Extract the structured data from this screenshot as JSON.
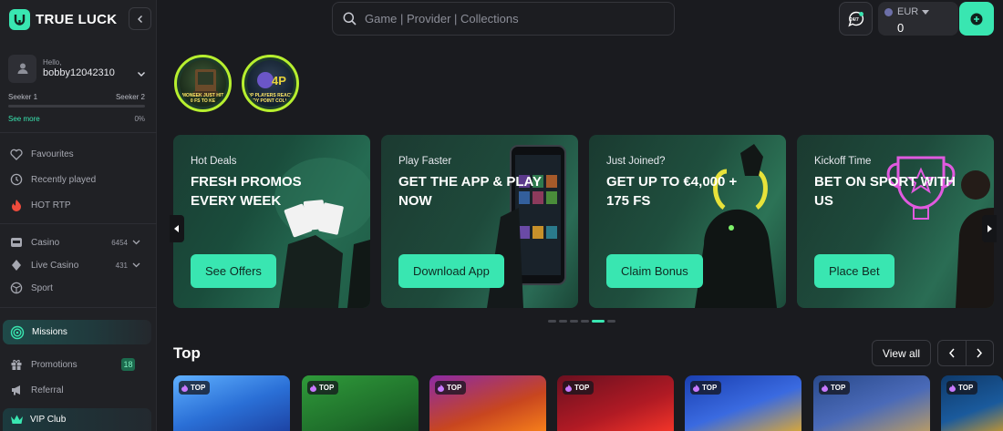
{
  "brand": {
    "name": "TRUE LUCK"
  },
  "user": {
    "greeting": "Hello,",
    "username": "bobby12042310"
  },
  "level": {
    "current": "Seeker 1",
    "next": "Seeker 2",
    "see_more": "See more",
    "progress_label": "0%",
    "progress": 0
  },
  "nav": {
    "favourites": "Favourites",
    "recently_played": "Recently played",
    "hot_rtp": "HOT RTP",
    "casino": {
      "label": "Casino",
      "count": "6454"
    },
    "live_casino": {
      "label": "Live Casino",
      "count": "431"
    },
    "sport": "Sport",
    "missions": "Missions",
    "promotions": {
      "label": "Promotions",
      "badge": "18"
    },
    "referral": "Referral",
    "vip_club": "VIP Club"
  },
  "header": {
    "search_placeholder": "Game | Provider | Collections",
    "chat_label": "24/7",
    "currency": "EUR",
    "balance": "0"
  },
  "stories": [
    {
      "caption1": "MONEEK JUST HIT",
      "caption2": "0 FS TO KE"
    },
    {
      "caption1": "OP PLAYERS REACH",
      "caption2": "DY POINT COLL"
    }
  ],
  "promos": [
    {
      "subtitle": "Hot Deals",
      "title": "FRESH PROMOS EVERY WEEK",
      "button": "See Offers"
    },
    {
      "subtitle": "Play Faster",
      "title": "GET THE APP & PLAY NOW",
      "button": "Download App"
    },
    {
      "subtitle": "Just Joined?",
      "title": "GET UP TO €4,000 + 175 FS",
      "button": "Claim Bonus"
    },
    {
      "subtitle": "Kickoff Time",
      "title": "BET ON SPORT WITH US",
      "button": "Place Bet"
    }
  ],
  "carousel": {
    "slides": 6,
    "active_index": 4
  },
  "top_section": {
    "title": "Top",
    "view_all": "View all",
    "badge_label": "TOP",
    "game_count": 7
  },
  "colors": {
    "accent": "#39e6b1",
    "background": "#1a1b1f",
    "sidebar": "#202125"
  }
}
